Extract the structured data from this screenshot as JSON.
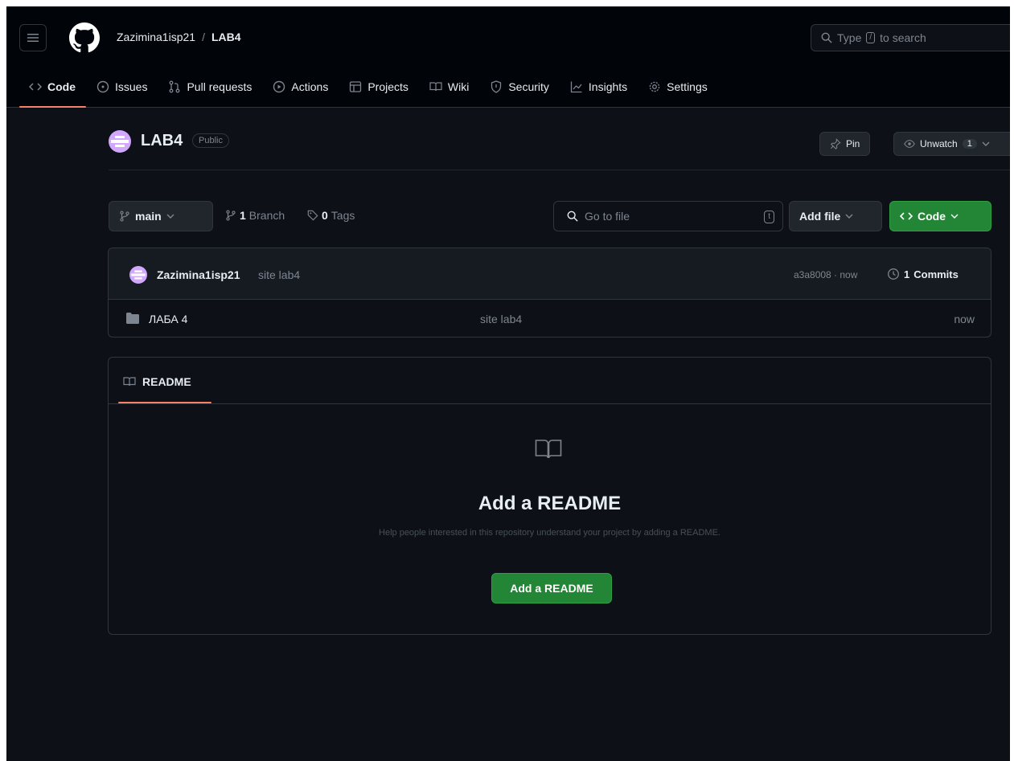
{
  "header": {
    "owner": "Zazimina1isp21",
    "separator": "/",
    "repo": "LAB4",
    "search_placeholder_pre": "Type",
    "search_key": "/",
    "search_placeholder_post": "to search"
  },
  "tabs": [
    {
      "label": "Code",
      "icon": "code-icon",
      "active": true
    },
    {
      "label": "Issues",
      "icon": "issue-icon"
    },
    {
      "label": "Pull requests",
      "icon": "pull-request-icon"
    },
    {
      "label": "Actions",
      "icon": "play-icon"
    },
    {
      "label": "Projects",
      "icon": "table-icon"
    },
    {
      "label": "Wiki",
      "icon": "book-icon"
    },
    {
      "label": "Security",
      "icon": "shield-icon"
    },
    {
      "label": "Insights",
      "icon": "graph-icon"
    },
    {
      "label": "Settings",
      "icon": "gear-icon"
    }
  ],
  "repo_header": {
    "name": "LAB4",
    "visibility": "Public",
    "pin_label": "Pin",
    "unwatch_label": "Unwatch",
    "watch_count": "1"
  },
  "toolbar": {
    "branch": "main",
    "branch_count": "1",
    "branch_label": "Branch",
    "tag_count": "0",
    "tag_label": "Tags",
    "goto_placeholder": "Go to file",
    "goto_key": "t",
    "add_file_label": "Add file",
    "code_label": "Code"
  },
  "latest_commit": {
    "author": "Zazimina1isp21",
    "message": "site lab4",
    "hash_time": "a3a8008 · now",
    "commits_count": "1",
    "commits_label": "Commits"
  },
  "files": [
    {
      "name": "ЛАБА 4",
      "message": "site lab4",
      "date": "now",
      "type": "folder"
    }
  ],
  "readme": {
    "tab_label": "README",
    "title": "Add a README",
    "subtitle": "Help people interested in this repository understand your project by adding a README.",
    "button_label": "Add a README"
  },
  "colors": {
    "background": "#0d1117",
    "header_bg": "#010409",
    "accent_green": "#238636",
    "active_underline": "#f78166",
    "avatar": "#d2a8ff"
  }
}
